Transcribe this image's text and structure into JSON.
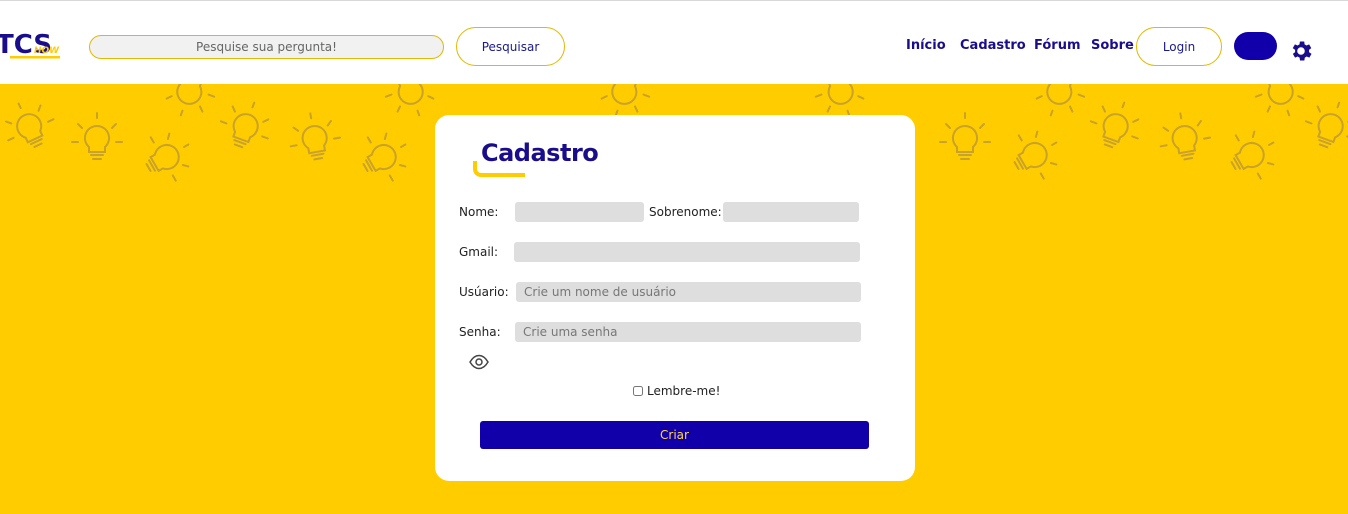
{
  "header": {
    "logo": {
      "text_top": "TCS",
      "text_side": "HOW"
    },
    "search": {
      "placeholder": "Pesquise sua pergunta!",
      "value": ""
    },
    "search_button": "Pesquisar",
    "nav": [
      "Início",
      "Cadastro",
      "Fórum",
      "Sobre"
    ],
    "login_button": "Login",
    "settings_icon": "gear-icon"
  },
  "form": {
    "title": "Cadastro",
    "fields": {
      "nome": {
        "label": "Nome:",
        "value": "",
        "placeholder": ""
      },
      "sobrenome": {
        "label": "Sobrenome:",
        "value": "",
        "placeholder": ""
      },
      "gmail": {
        "label": "Gmail:",
        "value": "",
        "placeholder": ""
      },
      "usuario": {
        "label": "Usúario:",
        "value": "",
        "placeholder": "Crie um nome de usuário"
      },
      "senha": {
        "label": "Senha:",
        "value": "",
        "placeholder": "Crie uma senha"
      }
    },
    "show_password_icon": "eye-icon",
    "remember_label": "Lembre-me!",
    "remember_checked": false,
    "submit": "Criar"
  },
  "colors": {
    "accent_blue": "#1100aa",
    "nav_text": "#1a0d8c",
    "background_yellow": "#ffcc00",
    "pattern_stroke": "#c9a22a",
    "field_gray": "#dedede"
  }
}
